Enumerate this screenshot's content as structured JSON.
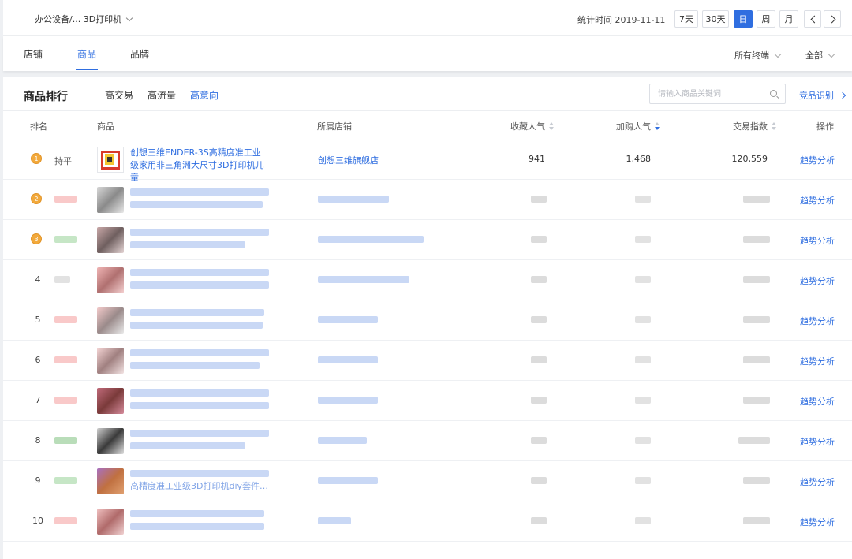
{
  "header": {
    "breadcrumb": "办公设备/... 3D打印机",
    "stat_time_label": "统计时间",
    "stat_time_value": "2019-11-11",
    "periods": [
      "7天",
      "30天",
      "日",
      "周",
      "月"
    ],
    "active_period": "日"
  },
  "main_tabs": [
    {
      "label": "店铺",
      "active": false
    },
    {
      "label": "商品",
      "active": true
    },
    {
      "label": "品牌",
      "active": false
    }
  ],
  "filters": {
    "terminal": "所有终端",
    "scope": "全部"
  },
  "ranking": {
    "title": "商品排行",
    "tabs": [
      {
        "label": "高交易",
        "active": false
      },
      {
        "label": "高流量",
        "active": false
      },
      {
        "label": "高意向",
        "active": true
      }
    ],
    "search_placeholder": "请输入商品关键词",
    "competitor_link": "竞品识别",
    "columns": {
      "rank": "排名",
      "product": "商品",
      "shop": "所属店铺",
      "favorites": "收藏人气",
      "cart": "加购人气",
      "trade_index": "交易指数",
      "action": "操作"
    },
    "rows": [
      {
        "rank": "1",
        "change": "持平",
        "title": "创想三维ENDER-3S高精度准工业级家用非三角洲大尺寸3D打印机儿童",
        "shop": "创想三维旗舰店",
        "favorites": "941",
        "cart": "1,468",
        "trade_index": "120,559",
        "action": "趋势分析"
      },
      {
        "rank": "2",
        "action": "趋势分析"
      },
      {
        "rank": "3",
        "action": "趋势分析"
      },
      {
        "rank": "4",
        "action": "趋势分析"
      },
      {
        "rank": "5",
        "action": "趋势分析"
      },
      {
        "rank": "6",
        "action": "趋势分析"
      },
      {
        "rank": "7",
        "action": "趋势分析"
      },
      {
        "rank": "8",
        "action": "趋势分析"
      },
      {
        "rank": "9",
        "title_partial": "高精度准工业级3D打印机diy套件…",
        "action": "趋势分析"
      },
      {
        "rank": "10",
        "action": "趋势分析"
      }
    ]
  },
  "colors": {
    "accent": "#2f6ee0",
    "medal": "#f2a93b"
  }
}
